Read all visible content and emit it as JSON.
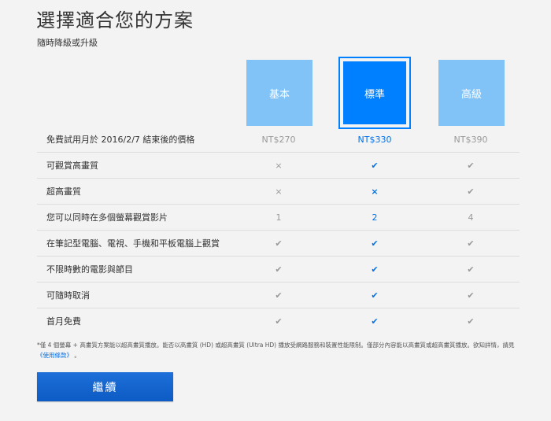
{
  "header": {
    "title": "選擇適合您的方案",
    "subtitle": "隨時降級或升級"
  },
  "plans": [
    {
      "name": "基本",
      "price": "NT$270",
      "selected": false
    },
    {
      "name": "標準",
      "price": "NT$330",
      "selected": true
    },
    {
      "name": "高級",
      "price": "NT$390",
      "selected": false
    }
  ],
  "price_row_label": "免費試用月於 2016/2/7 結束後的價格",
  "features": [
    {
      "label": "可觀賞高畫質",
      "values": [
        "×",
        "✔",
        "✔"
      ]
    },
    {
      "label": "超高畫質",
      "values": [
        "×",
        "×",
        "✔"
      ]
    },
    {
      "label": "您可以同時在多個螢幕觀賞影片",
      "values": [
        "1",
        "2",
        "4"
      ]
    },
    {
      "label": "在筆記型電腦、電視、手機和平板電腦上觀賞",
      "values": [
        "✔",
        "✔",
        "✔"
      ]
    },
    {
      "label": "不限時數的電影與節目",
      "values": [
        "✔",
        "✔",
        "✔"
      ]
    },
    {
      "label": "可隨時取消",
      "values": [
        "✔",
        "✔",
        "✔"
      ]
    },
    {
      "label": "首月免費",
      "values": [
        "✔",
        "✔",
        "✔"
      ]
    }
  ],
  "footnote": {
    "text": "*僅 4 個螢幕 + 高畫質方案能以超高畫質播放。能否以高畫質 (HD) 或超高畫質 (Ultra HD) 播放受網路服務和裝置性能限制。僅部分內容能以高畫質或超高畫質播放。欲知詳情，請見",
    "link": "《使用條款》",
    "end": "。"
  },
  "continue_label": "繼續",
  "colors": {
    "plan_default": "#82c3f7",
    "plan_selected": "#0080ff",
    "highlight_text": "#0071eb",
    "button": "#1565d3"
  }
}
